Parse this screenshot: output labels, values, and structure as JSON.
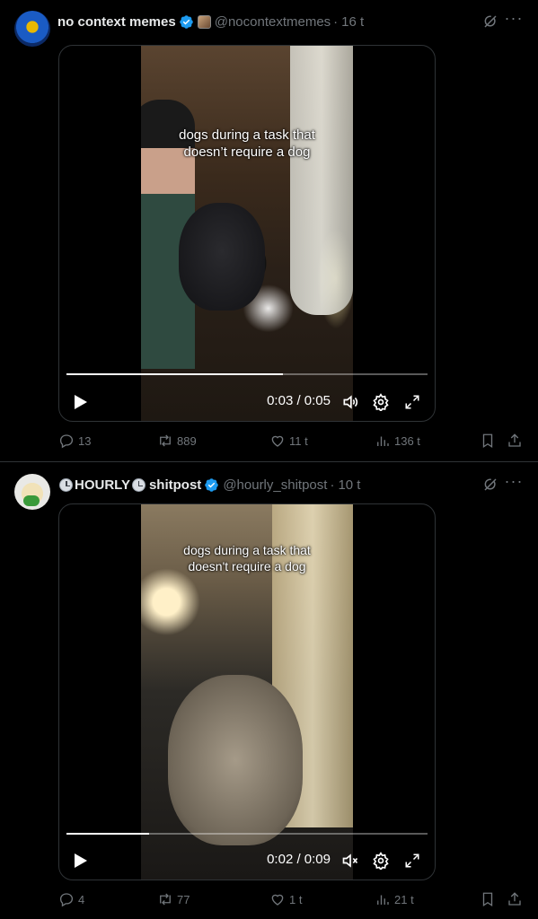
{
  "tweets": [
    {
      "name": "no context memes",
      "handle": "@nocontextmemes",
      "dot": "·",
      "time": "16 t",
      "caption_line1": "dogs during a task that",
      "caption_line2": "doesn’t require a dog",
      "timecode": "0:03 / 0:05",
      "progress": 0.6,
      "muted": false,
      "replies": "13",
      "reposts": "889",
      "likes": "11 t",
      "views": "136 t"
    },
    {
      "name_part1": "HOURLY",
      "name_part2": "shitpost",
      "handle": "@hourly_shitpost",
      "dot": "·",
      "time": "10 t",
      "caption_line1": "dogs during a task that",
      "caption_line2": "doesn't require a dog",
      "timecode": "0:02 / 0:09",
      "progress": 0.23,
      "muted": true,
      "replies": "4",
      "reposts": "77",
      "likes": "1 t",
      "views": "21 t"
    }
  ],
  "icons": {
    "verified": "verified-badge-icon",
    "affiliate": "affiliate-badge-icon",
    "grok": "grok-icon",
    "more": "more-icon",
    "play": "play-icon",
    "volume": "volume-icon",
    "muted": "muted-icon",
    "settings": "settings-icon",
    "fullscreen": "fullscreen-icon",
    "reply": "reply-icon",
    "repost": "repost-icon",
    "like": "like-icon",
    "views": "views-icon",
    "bookmark": "bookmark-icon",
    "share": "share-icon",
    "clock": "clock-icon"
  },
  "colors": {
    "verified": "#1d9bf0",
    "muted_text": "#71767b",
    "text": "#e7e9ea",
    "border": "#2f3336"
  }
}
